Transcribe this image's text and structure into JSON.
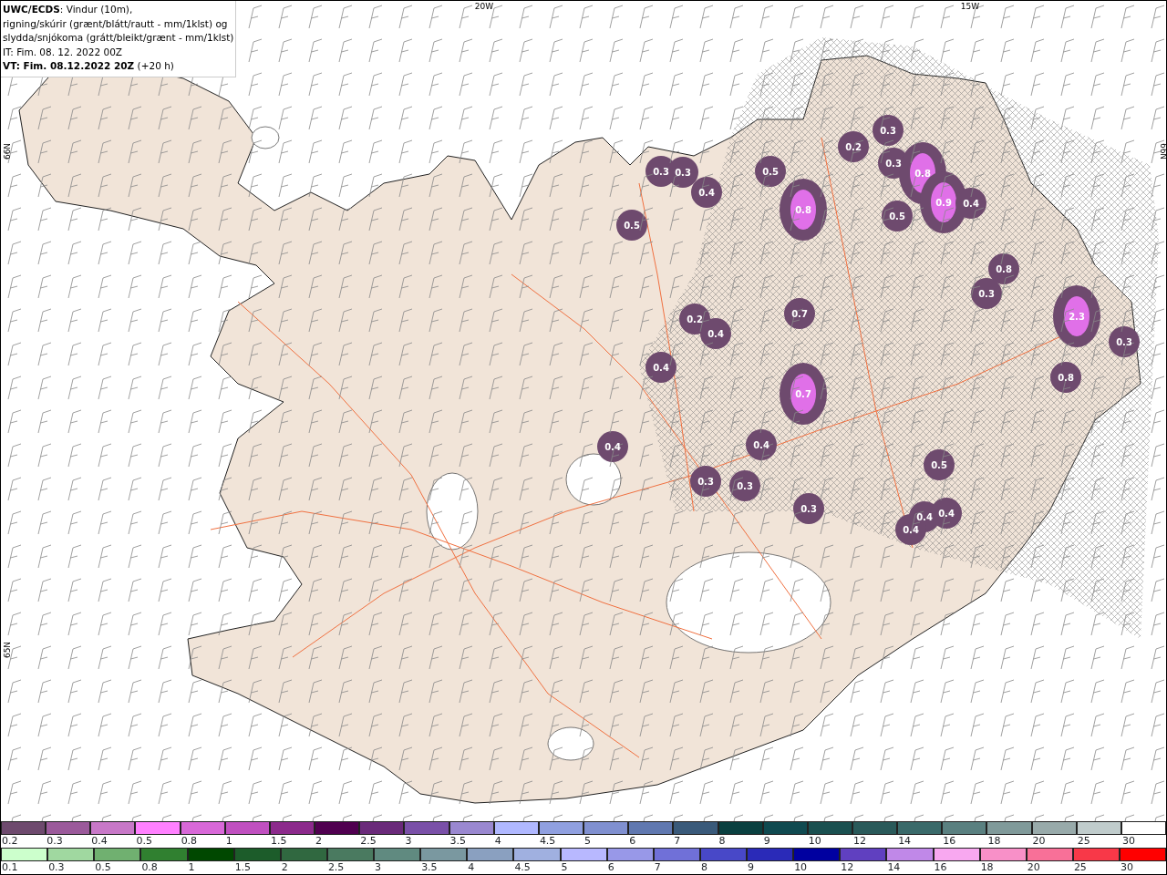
{
  "header": {
    "lines": [
      "**UWC/ECDS**: Vindur (10m),",
      "rigning/skúrir (grænt/blátt/rautt - mm/1klst) og",
      "slydda/snjókoma (grátt/bleikt/grænt - mm/1klst)",
      "IT: Fim. 08. 12. 2022 00Z",
      "**VT: Fim. 08.12.2022 20Z** (+20 h)"
    ]
  },
  "map": {
    "graticule_labels": [
      "20W",
      "15W",
      "66N",
      "65N",
      "66N"
    ],
    "precip_values": [
      "0.3",
      "0.2",
      "0.3",
      "0.3",
      "0.5",
      "0.3",
      "0.8",
      "0.4",
      "0.9",
      "0.4",
      "0.8",
      "0.5",
      "0.5",
      "0.8",
      "0.3",
      "0.7",
      "0.2",
      "2.3",
      "0.4",
      "0.3",
      "0.4",
      "0.8",
      "0.7",
      "0.4",
      "0.4",
      "0.5",
      "0.3",
      "0.3",
      "0.3",
      "0.4",
      "0.4",
      "0.4"
    ]
  },
  "legend": [
    {
      "items": [
        {
          "label": "0.2",
          "color": "#6e4a6e"
        },
        {
          "label": "0.3",
          "color": "#9b5a9b"
        },
        {
          "label": "0.4",
          "color": "#c878c8"
        },
        {
          "label": "0.5",
          "color": "#ff80ff"
        },
        {
          "label": "0.8",
          "color": "#d868d8"
        },
        {
          "label": "1",
          "color": "#c050c0"
        },
        {
          "label": "1.5",
          "color": "#8c2a8c"
        },
        {
          "label": "2",
          "color": "#500050"
        },
        {
          "label": "2.5",
          "color": "#6a2a7a"
        },
        {
          "label": "3",
          "color": "#7a50a8"
        },
        {
          "label": "3.5",
          "color": "#9a88d0"
        },
        {
          "label": "4",
          "color": "#b0b8ff"
        },
        {
          "label": "4.5",
          "color": "#90a0e0"
        },
        {
          "label": "5",
          "color": "#8090d0"
        },
        {
          "label": "6",
          "color": "#6078b0"
        },
        {
          "label": "7",
          "color": "#3a5a7a"
        },
        {
          "label": "8",
          "color": "#0a4040"
        },
        {
          "label": "9",
          "color": "#104a50"
        },
        {
          "label": "10",
          "color": "#1a5050"
        },
        {
          "label": "12",
          "color": "#2a5a5a"
        },
        {
          "label": "14",
          "color": "#3a6a6a"
        },
        {
          "label": "16",
          "color": "#5a8080"
        },
        {
          "label": "18",
          "color": "#809a9a"
        },
        {
          "label": "20",
          "color": "#98aaaa"
        },
        {
          "label": "25",
          "color": "#c0cccc"
        },
        {
          "label": "30",
          "color": "#ffffff"
        }
      ]
    },
    {
      "items": [
        {
          "label": "0.1",
          "color": "#ccffcc"
        },
        {
          "label": "0.3",
          "color": "#a0d8a0"
        },
        {
          "label": "0.5",
          "color": "#70b070"
        },
        {
          "label": "0.8",
          "color": "#308030"
        },
        {
          "label": "1",
          "color": "#004800"
        },
        {
          "label": "1.5",
          "color": "#1c5c2a"
        },
        {
          "label": "2",
          "color": "#306840"
        },
        {
          "label": "2.5",
          "color": "#4a7a60"
        },
        {
          "label": "3",
          "color": "#608a80"
        },
        {
          "label": "3.5",
          "color": "#7a98a0"
        },
        {
          "label": "4",
          "color": "#8aa0c0"
        },
        {
          "label": "4.5",
          "color": "#a0b0e0"
        },
        {
          "label": "5",
          "color": "#b8b8ff"
        },
        {
          "label": "6",
          "color": "#9898e8"
        },
        {
          "label": "7",
          "color": "#7070d8"
        },
        {
          "label": "8",
          "color": "#4848c8"
        },
        {
          "label": "9",
          "color": "#2a2ab8"
        },
        {
          "label": "10",
          "color": "#0000a0"
        },
        {
          "label": "12",
          "color": "#6040c0"
        },
        {
          "label": "14",
          "color": "#c088e8"
        },
        {
          "label": "16",
          "color": "#f8a8f0"
        },
        {
          "label": "18",
          "color": "#f890c8"
        },
        {
          "label": "20",
          "color": "#f87098"
        },
        {
          "label": "25",
          "color": "#f83848"
        },
        {
          "label": "30",
          "color": "#ff0000"
        }
      ]
    }
  ]
}
